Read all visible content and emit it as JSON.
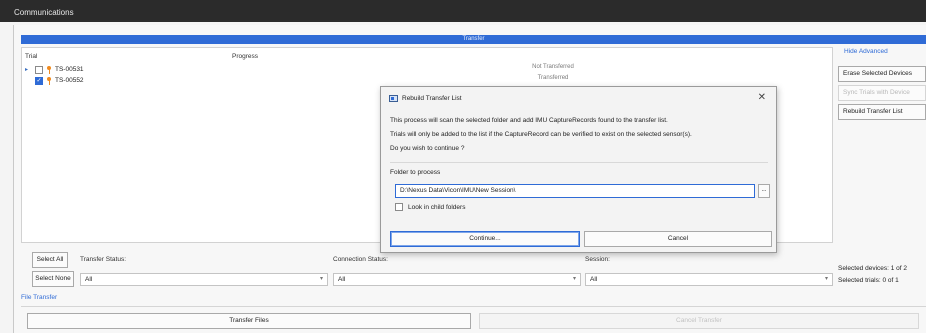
{
  "window": {
    "title": "Communications"
  },
  "transfer_header": "Transfer",
  "trial_panel": {
    "columns": {
      "trial": "Trial",
      "progress": "Progress"
    },
    "trials": [
      {
        "name": "TS-00531",
        "checked": false,
        "expanded": false,
        "status": "Not Transferred"
      },
      {
        "name": "TS-00552",
        "checked": true,
        "expanded": false,
        "status": "Transferred"
      }
    ]
  },
  "side_panel": {
    "hide_advanced": "Hide Advanced",
    "erase_selected_devices": "Erase Selected Devices",
    "sync_trials_with_device": "Sync Trials with Device",
    "rebuild_transfer_list": "Rebuild Transfer List"
  },
  "filters": {
    "select_all": "Select All",
    "select_none": "Select None",
    "transfer_status_label": "Transfer Status:",
    "transfer_status_value": "All",
    "connection_status_label": "Connection Status:",
    "connection_status_value": "All",
    "session_label": "Session:",
    "session_value": "All"
  },
  "selection_info": {
    "devices_label": "Selected devices:",
    "devices_value": "1 of 2",
    "trials_label": "Selected trials:",
    "trials_value": "0 of 1"
  },
  "file_transfer_link": "File Transfer",
  "bottom_buttons": {
    "transfer_files": "Transfer Files",
    "cancel_transfer": "Cancel Transfer"
  },
  "dialog": {
    "title": "Rebuild Transfer List",
    "close_glyph": "✕",
    "message_line1": "This process will scan the selected folder and add IMU CaptureRecords found to the transfer list.",
    "message_line2": "Trials will only be added to the list if the CaptureRecord can be verified to exist on the selected sensor(s).",
    "message_line3": "Do you wish to continue ?",
    "folder_label": "Folder to process",
    "folder_value": "D:\\Nexus Data\\Vicon\\IMU\\New Session\\",
    "browse_label": "...",
    "look_in_child_folders": "Look in child folders",
    "look_in_child_checked": false,
    "continue_label": "Continue...",
    "cancel_label": "Cancel"
  },
  "colors": {
    "accent": "#2f6bd6",
    "titlebar": "#2b2b2b",
    "trial_icon": "#f08a1e"
  },
  "icons": {
    "trial": "person-icon",
    "app": "app-window-icon"
  }
}
